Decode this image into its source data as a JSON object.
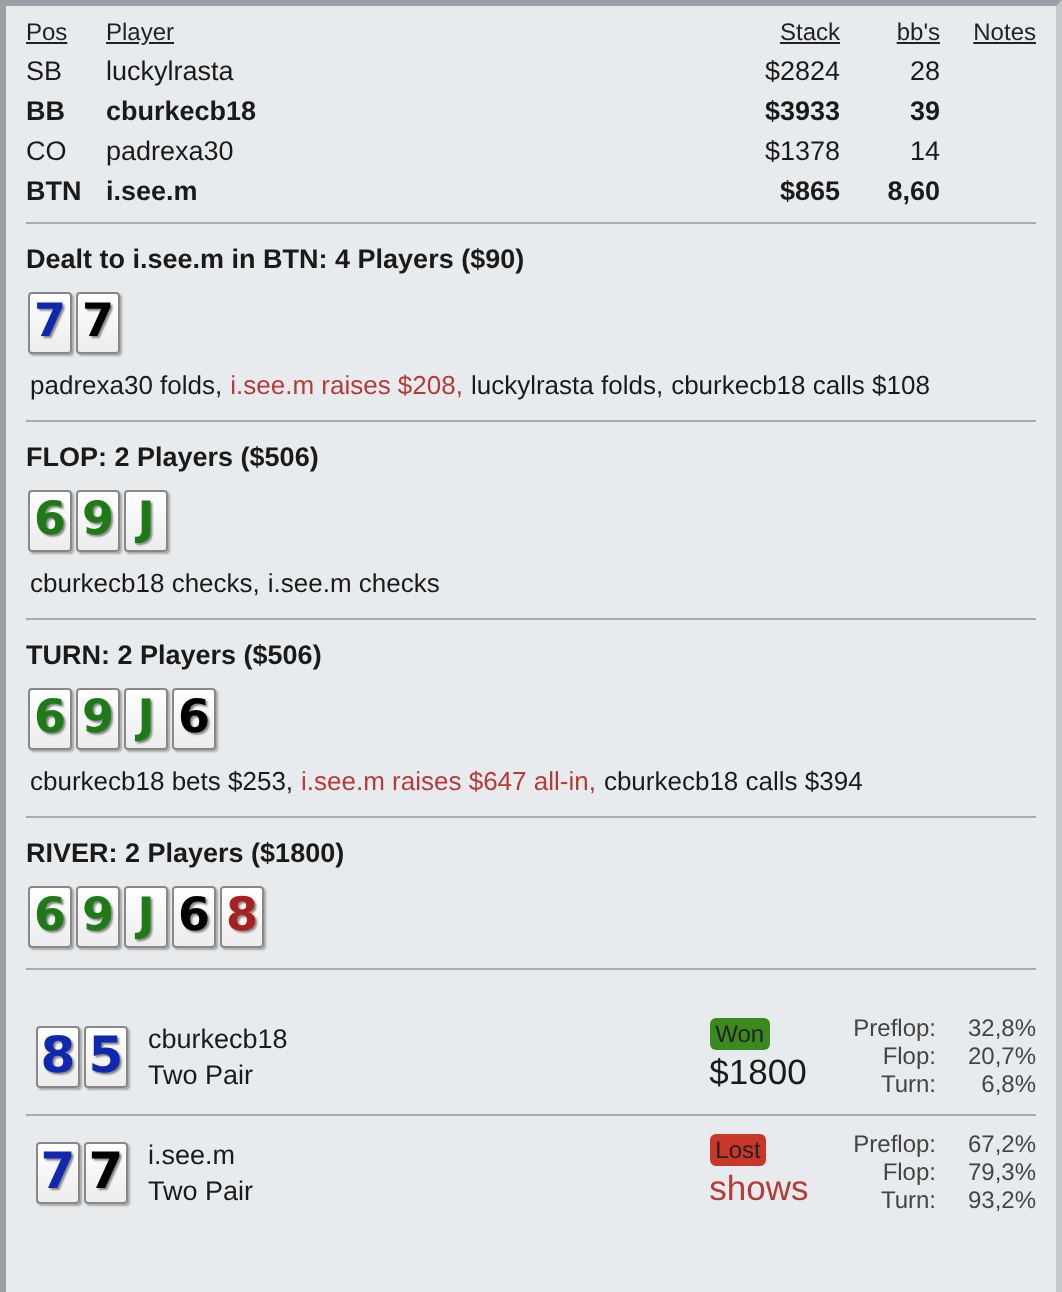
{
  "players": {
    "columns": [
      "Pos",
      "Player",
      "Stack",
      "bb's",
      "Notes"
    ],
    "rows": [
      {
        "pos": "SB",
        "name": "luckylrasta",
        "stack": "$2824",
        "bbs": "28",
        "in_hand": false
      },
      {
        "pos": "BB",
        "name": "cburkecb18",
        "stack": "$3933",
        "bbs": "39",
        "in_hand": true
      },
      {
        "pos": "CO",
        "name": "padrexa30",
        "stack": "$1378",
        "bbs": "14",
        "in_hand": false
      },
      {
        "pos": "BTN",
        "name": "i.see.m",
        "stack": "$865",
        "bbs": "8,60",
        "in_hand": true
      }
    ]
  },
  "streets": [
    {
      "title": "Dealt to i.see.m in BTN: 4 Players ($90)",
      "cards": [
        {
          "rank": "7",
          "color": "#1028b0"
        },
        {
          "rank": "7",
          "color": "#000000"
        }
      ],
      "actions": [
        {
          "text": "padrexa30 folds,",
          "hero": false
        },
        {
          "text": "i.see.m raises $208,",
          "hero": true
        },
        {
          "text": "luckylrasta folds,",
          "hero": false
        },
        {
          "text": "cburkecb18 calls $108",
          "hero": false
        }
      ]
    },
    {
      "title": "FLOP: 2 Players ($506)",
      "cards": [
        {
          "rank": "6",
          "color": "#1d7a16"
        },
        {
          "rank": "9",
          "color": "#1d7a16"
        },
        {
          "rank": "J",
          "color": "#1d7a16"
        }
      ],
      "actions": [
        {
          "text": "cburkecb18 checks,",
          "hero": false
        },
        {
          "text": "i.see.m checks",
          "hero": false
        }
      ]
    },
    {
      "title": "TURN: 2 Players ($506)",
      "cards": [
        {
          "rank": "6",
          "color": "#1d7a16"
        },
        {
          "rank": "9",
          "color": "#1d7a16"
        },
        {
          "rank": "J",
          "color": "#1d7a16"
        },
        {
          "rank": "6",
          "color": "#000000"
        }
      ],
      "actions": [
        {
          "text": "cburkecb18 bets $253,",
          "hero": false
        },
        {
          "text": "i.see.m raises $647 all-in,",
          "hero": true
        },
        {
          "text": "cburkecb18 calls $394",
          "hero": false
        }
      ]
    },
    {
      "title": "RIVER: 2 Players ($1800)",
      "cards": [
        {
          "rank": "6",
          "color": "#1d7a16"
        },
        {
          "rank": "9",
          "color": "#1d7a16"
        },
        {
          "rank": "J",
          "color": "#1d7a16"
        },
        {
          "rank": "6",
          "color": "#000000"
        },
        {
          "rank": "8",
          "color": "#a82020"
        }
      ]
    }
  ],
  "results": [
    {
      "cards": [
        {
          "rank": "8",
          "color": "#1028b0"
        },
        {
          "rank": "5",
          "color": "#1028b0"
        }
      ],
      "name": "cburkecb18",
      "hand": "Two Pair",
      "kind": "won",
      "badge": "Won",
      "amount": "$1800",
      "equity": [
        {
          "label": "Preflop:",
          "value": "32,8%"
        },
        {
          "label": "Flop:",
          "value": "20,7%"
        },
        {
          "label": "Turn:",
          "value": "6,8%"
        }
      ]
    },
    {
      "cards": [
        {
          "rank": "7",
          "color": "#1028b0"
        },
        {
          "rank": "7",
          "color": "#000000"
        }
      ],
      "name": "i.see.m",
      "hand": "Two Pair",
      "kind": "lost",
      "badge": "Lost",
      "amount": "shows",
      "equity": [
        {
          "label": "Preflop:",
          "value": "67,2%"
        },
        {
          "label": "Flop:",
          "value": "79,3%"
        },
        {
          "label": "Turn:",
          "value": "93,2%"
        }
      ]
    }
  ]
}
